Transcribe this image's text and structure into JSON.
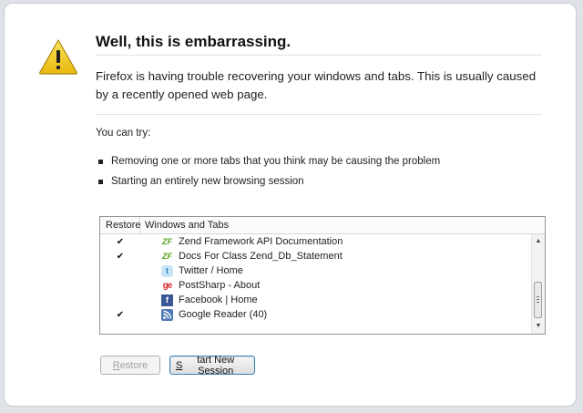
{
  "heading": "Well, this is embarrassing.",
  "description": "Firefox is having trouble recovering your windows and tabs. This is usually caused by a recently opened web page.",
  "try_label": "You can try:",
  "suggestions": [
    "Removing one or more tabs that you think may be causing the problem",
    "Starting an entirely new browsing session"
  ],
  "tree": {
    "columns": {
      "restore": "Restore",
      "windows": "Windows and Tabs"
    },
    "rows": [
      {
        "checked": "✔",
        "icon": "zend-icon",
        "glyph": "ZF",
        "label": "Zend Framework API Documentation"
      },
      {
        "checked": "✔",
        "icon": "zend-icon",
        "glyph": "ZF",
        "label": "Docs For Class Zend_Db_Statement"
      },
      {
        "checked": "",
        "icon": "twitter-icon",
        "glyph": "t",
        "label": "Twitter / Home"
      },
      {
        "checked": "",
        "icon": "postsharp-icon",
        "glyph": "ge",
        "label": "PostSharp - About"
      },
      {
        "checked": "",
        "icon": "facebook-icon",
        "glyph": "f",
        "label": "Facebook | Home"
      },
      {
        "checked": "✔",
        "icon": "google-reader-icon",
        "glyph": "",
        "label": "Google Reader (40)"
      }
    ]
  },
  "buttons": {
    "restore": {
      "prefix": "",
      "accel": "R",
      "rest": "estore"
    },
    "new_session": {
      "prefix": "",
      "accel": "S",
      "rest": "tart New Session"
    }
  },
  "colors": {
    "warning": "#f2d21a",
    "accent": "#3c7fb1"
  }
}
